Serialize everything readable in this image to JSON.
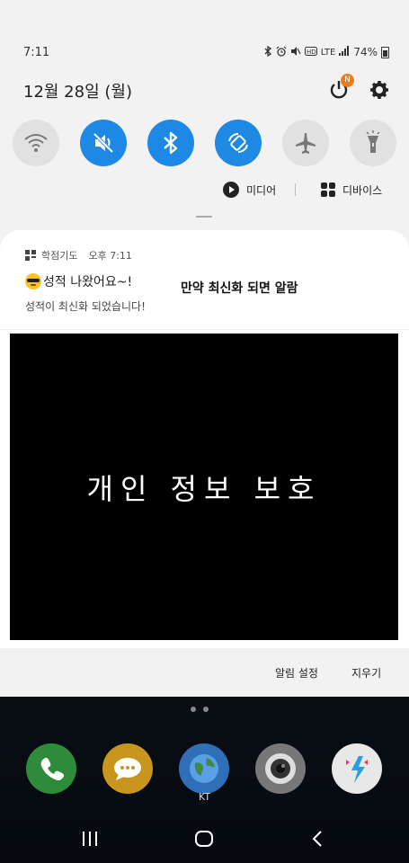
{
  "status_bar": {
    "time": "7:11",
    "network": "LTE",
    "battery": "74%"
  },
  "header": {
    "date": "12월 28일 (월)",
    "notification_badge": "N"
  },
  "quick_settings": [
    {
      "icon": "wifi-icon",
      "state": "off"
    },
    {
      "icon": "sound-mute-icon",
      "state": "on"
    },
    {
      "icon": "bluetooth-icon",
      "state": "on"
    },
    {
      "icon": "auto-rotate-icon",
      "state": "on"
    },
    {
      "icon": "airplane-icon",
      "state": "off"
    },
    {
      "icon": "flashlight-icon",
      "state": "off"
    }
  ],
  "media_bar": {
    "media_label": "미디어",
    "devices_label": "디바이스"
  },
  "notification": {
    "app_name": "학점기도",
    "time": "오후 7:11",
    "title": "성적 나왔어요~!",
    "body": "성적이 최신화 되었습니다!",
    "overlay_note": "만약 최신화 되면 알람"
  },
  "privacy_overlay": {
    "text": "개인 정보 보호"
  },
  "actions": {
    "settings_label": "알림 설정",
    "clear_label": "지우기"
  },
  "dock": {
    "carrier_label": "KT"
  },
  "colors": {
    "accent": "#1e88e5",
    "badge": "#f07b12",
    "panel": "#f2f2f2"
  }
}
